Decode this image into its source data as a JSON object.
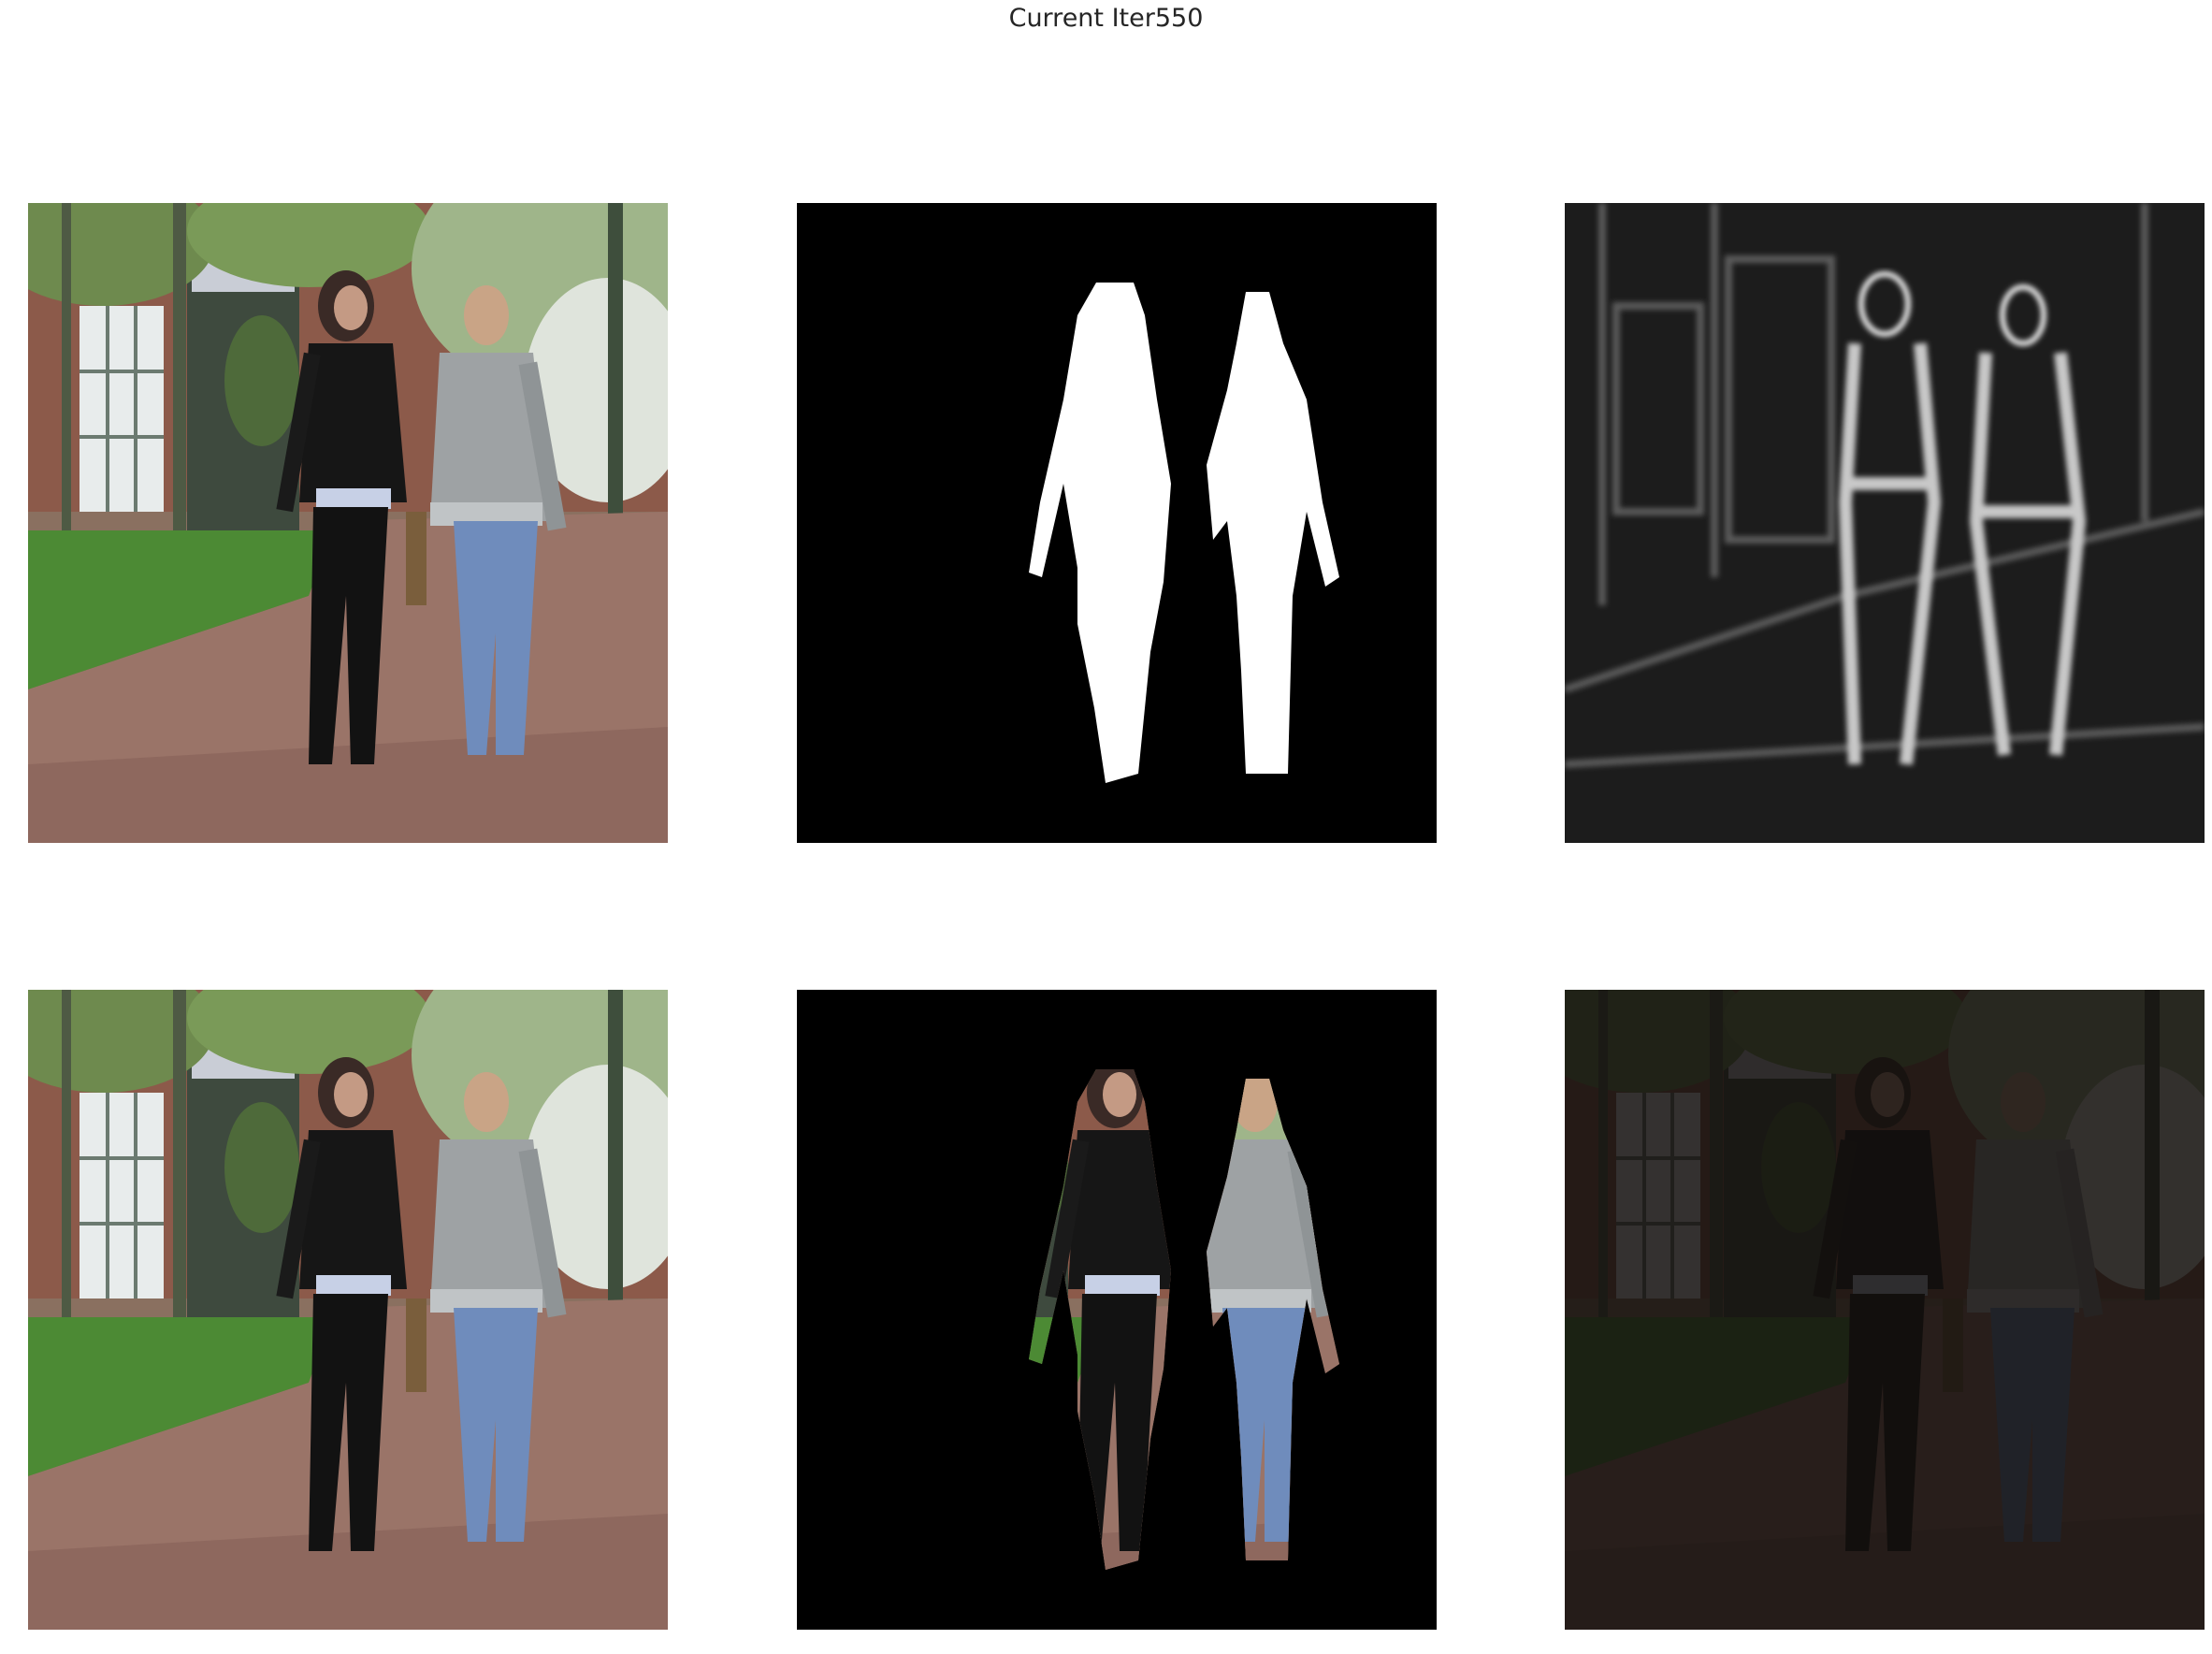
{
  "figure": {
    "suptitle": "Current Iter550"
  },
  "panels": [
    {
      "row": 1,
      "col": 1,
      "content": "original-photo",
      "icon": "photo-two-people-walking"
    },
    {
      "row": 1,
      "col": 2,
      "content": "binary-mask",
      "icon": "white-silhouettes-on-black"
    },
    {
      "row": 1,
      "col": 3,
      "content": "grayscale-map",
      "icon": "grayscale-edge-map"
    },
    {
      "row": 2,
      "col": 1,
      "content": "original-photo",
      "icon": "photo-two-people-walking"
    },
    {
      "row": 2,
      "col": 2,
      "content": "masked-foreground",
      "icon": "people-cutout-on-black"
    },
    {
      "row": 2,
      "col": 3,
      "content": "dark-reconstruction",
      "icon": "dark-reconstruction"
    }
  ],
  "colors": {
    "background": "#ffffff",
    "mask_bg": "#000000",
    "mask_fg": "#ffffff"
  }
}
